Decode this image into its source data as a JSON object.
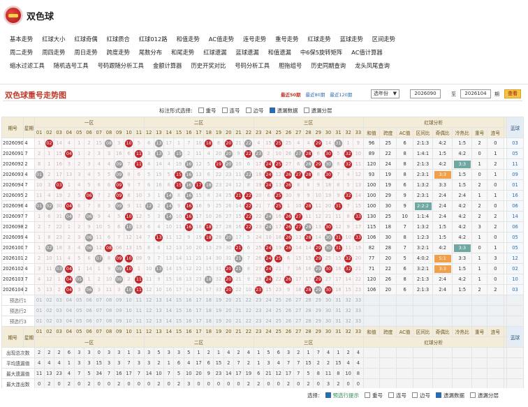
{
  "app": {
    "title": "双色球"
  },
  "nav": [
    [
      "基本走势",
      "红球大小",
      "红球奇偶",
      "红球质合",
      "红球012路",
      "和值走势",
      "AC值走势",
      "连号走势",
      "重号走势",
      "红球走势",
      "蓝球走势",
      "区间走势"
    ],
    [
      "周二走势",
      "周四走势",
      "周日走势",
      "跨度走势",
      "尾数分布",
      "和尾走势",
      "红球遗漏",
      "蓝球遗漏",
      "和值遗漏",
      "中6保5旋转矩阵",
      "AC值计算器"
    ],
    [
      "缩水过滤工具",
      "随机选号工具",
      "号码跟随分析工具",
      "金额计算器",
      "历史开奖对比",
      "号码分析工具",
      "胆拖组号",
      "历史同期查询",
      "龙头凤尾查询"
    ]
  ],
  "header": {
    "title": "双色球重号走势图",
    "ranges": [
      "最近50期",
      "最近80期",
      "最近120期"
    ],
    "select": "选年份",
    "from": "2026090",
    "to": "2026104",
    "to_label": "至",
    "period_unit": "期",
    "button": "查看"
  },
  "top_opts": {
    "label": "标注形式选择:",
    "items": [
      {
        "text": "重号",
        "on": false
      },
      {
        "text": "连号",
        "on": false
      },
      {
        "text": "边号",
        "on": false
      },
      {
        "text": "遗漏数据",
        "on": true
      },
      {
        "text": "遗漏分层",
        "on": false
      }
    ]
  },
  "foot_opts": {
    "label": "选择:",
    "items": [
      {
        "text": "预选行提示",
        "on": true
      },
      {
        "text": "重号",
        "on": false
      },
      {
        "text": "连号",
        "on": false
      },
      {
        "text": "边号",
        "on": false
      },
      {
        "text": "遗漏数据",
        "on": true
      },
      {
        "text": "遗漏分层",
        "on": false
      }
    ]
  },
  "table": {
    "zones": [
      "一区",
      "二区",
      "三区"
    ],
    "analysis_title": "红球分析",
    "period_label": "期号",
    "week_label": "星期",
    "blue_label": "蓝球",
    "analysis_cols": [
      "和值",
      "跨度",
      "AC值",
      "区间比",
      "奇偶比",
      "冷热比",
      "重号",
      "连号"
    ],
    "rows": [
      {
        "p": "2026090",
        "w": "4",
        "m": [
          "1",
          "02",
          "14",
          "4",
          "1",
          "2",
          "15",
          "5",
          "3",
          "2",
          "5",
          "6",
          "2",
          "17",
          "1",
          "7",
          "10",
          "3",
          "8",
          "3",
          "21",
          "8",
          "4",
          "15",
          "9",
          "25",
          "4",
          "4",
          "5",
          "14",
          "4",
          "1",
          "9"
        ],
        "b": [
          "02",
          "10",
          "18",
          "20",
          "25",
          "29"
        ],
        "g": [
          "08",
          "13",
          "22",
          "31"
        ],
        "a": [
          "96",
          "25",
          "6",
          "2:1:3",
          "4:2",
          "1:5",
          "2",
          "0"
        ],
        "t": [],
        "blue": "03"
      },
      {
        "p": "2026091",
        "w": "7",
        "m": [
          "2",
          "1",
          "15",
          "5",
          "1",
          "2",
          "3",
          "3",
          "16",
          "6",
          "4",
          "3",
          "13",
          "3",
          "18",
          "2",
          "11",
          "4",
          "20",
          "21",
          "9",
          "5",
          "16",
          "2",
          "10",
          "26",
          "5",
          "5",
          "6",
          "15",
          "5",
          "2",
          "10"
        ],
        "b": [
          "04",
          "11",
          "22",
          "28",
          "30",
          "32"
        ],
        "g": [
          "13",
          "15",
          "20",
          "23",
          "27"
        ],
        "a": [
          "89",
          "22",
          "8",
          "1:4:1",
          "1:5",
          "4:2",
          "0",
          "1"
        ],
        "t": [],
        "blue": "05"
      },
      {
        "p": "2026092",
        "w": "2",
        "m": [
          "8",
          "1",
          "16",
          "3",
          "2",
          "3",
          "4",
          "4",
          "17",
          "7",
          "5",
          "4",
          "14",
          "4",
          "19",
          "3",
          "12",
          "5",
          "21",
          "22",
          "10",
          "6",
          "17",
          "3",
          "11",
          "27",
          "6",
          "6",
          "7",
          "16",
          "6",
          "3",
          "11"
        ],
        "b": [
          "11",
          "19",
          "24",
          "25",
          "29",
          "32"
        ],
        "g": [
          "09",
          "16",
          "20",
          "28",
          "30"
        ],
        "a": [
          "120",
          "24",
          "8",
          "2:1:3",
          "4:2",
          "3:3",
          "1",
          "2"
        ],
        "t": [
          {
            "i": 5,
            "c": "t"
          }
        ],
        "blue": "11"
      },
      {
        "p": "2026093",
        "w": "4",
        "m": [
          "9",
          "2",
          "17",
          "13",
          "3",
          "4",
          "5",
          "5",
          "18",
          "8",
          "6",
          "5",
          "15",
          "5",
          "20",
          "4",
          "13",
          "6",
          "22",
          "23",
          "11",
          "7",
          "18",
          "4",
          "12",
          "28",
          "7",
          "7",
          "8",
          "17",
          "7",
          "4",
          "12"
        ],
        "b": [
          "15",
          "24",
          "26",
          "27",
          "28",
          "30"
        ],
        "g": [
          "01",
          "09",
          "16",
          "22"
        ],
        "a": [
          "93",
          "19",
          "8",
          "2:3:1",
          "3:3",
          "1:5",
          "0",
          "1"
        ],
        "t": [
          {
            "i": 4,
            "c": "o"
          }
        ],
        "blue": "09"
      },
      {
        "p": "2026094",
        "w": "7",
        "m": [
          "10",
          "3",
          "18",
          "1",
          "4",
          "5",
          "6",
          "6",
          "19",
          "9",
          "7",
          "6",
          "16",
          "6",
          "21",
          "5",
          "14",
          "7",
          "23",
          "24",
          "12",
          "8",
          "19",
          "5",
          "13",
          "29",
          "8",
          "8",
          "9",
          "18",
          "8",
          "5",
          "13"
        ],
        "b": [
          "03",
          "09",
          "15",
          "17",
          "24",
          "26"
        ],
        "g": [
          "16",
          "18",
          "24"
        ],
        "a": [
          "100",
          "19",
          "6",
          "1:3:2",
          "3:3",
          "1:5",
          "2",
          "0"
        ],
        "t": [],
        "blue": "01"
      },
      {
        "p": "2026095",
        "w": "2",
        "m": [
          "11",
          "4",
          "19",
          "2",
          "5",
          "6",
          "7",
          "2",
          "3",
          "8",
          "10",
          "3",
          "1",
          "7",
          "8",
          "6",
          "15",
          "8",
          "24",
          "25",
          "13",
          "1",
          "20",
          "6",
          "14",
          "30",
          "9",
          "9",
          "10",
          "19",
          "9",
          "6",
          "14"
        ],
        "b": [
          "06",
          "09",
          "21",
          "22",
          "25",
          "32"
        ],
        "g": [
          "14",
          "16",
          "22"
        ],
        "a": [
          "100",
          "29",
          "9",
          "2:3:1",
          "2:4",
          "2:4",
          "1",
          "1"
        ],
        "t": [],
        "blue": "16"
      },
      {
        "p": "2026096",
        "w": "4",
        "m": [
          "1",
          "5",
          "30",
          "3",
          "6",
          "7",
          "8",
          "3",
          "4",
          "9",
          "11",
          "4",
          "2",
          "8",
          "9",
          "7",
          "16",
          "9",
          "25",
          "26",
          "14",
          "2",
          "21",
          "7",
          "15",
          "1",
          "10",
          "10",
          "11",
          "20",
          "10",
          "7",
          "15"
        ],
        "b": [
          "04",
          "16",
          "22",
          "25",
          "28",
          "31"
        ],
        "g": [
          "01",
          "02",
          "09",
          "12",
          "14"
        ],
        "a": [
          "100",
          "30",
          "9",
          "2:2:2",
          "2:4",
          "4:2",
          "2",
          "0"
        ],
        "t": [
          {
            "i": 3,
            "c": "t"
          }
        ],
        "blue": "06"
      },
      {
        "p": "2026097",
        "w": "7",
        "m": [
          "1",
          "6",
          "31",
          "1",
          "7",
          "8",
          "9",
          "4",
          "5",
          "10",
          "12",
          "5",
          "3",
          "9",
          "10",
          "8",
          "17",
          "10",
          "26",
          "27",
          "15",
          "3",
          "22",
          "8",
          "16",
          "2",
          "11",
          "11",
          "12",
          "21",
          "11",
          "8",
          "16"
        ],
        "b": [
          "10",
          "16",
          "22",
          "26",
          "27",
          "33"
        ],
        "g": [
          "04",
          "06",
          "14",
          "22",
          "24"
        ],
        "a": [
          "130",
          "25",
          "10",
          "1:1:4",
          "2:4",
          "4:2",
          "2",
          "2"
        ],
        "t": [],
        "blue": "14"
      },
      {
        "p": "2026098",
        "w": "2",
        "m": [
          "2",
          "7",
          "22",
          "1",
          "2",
          "9",
          "10",
          "5",
          "6",
          "11",
          "13",
          "6",
          "4",
          "10",
          "11",
          "8",
          "18",
          "11",
          "27",
          "28",
          "16",
          "4",
          "23",
          "9",
          "17",
          "3",
          "12",
          "12",
          "13",
          "22",
          "12",
          "9",
          "17"
        ],
        "b": [
          "16",
          "18",
          "22",
          "26",
          "27",
          "30"
        ],
        "g": [
          "10",
          "24",
          "28"
        ],
        "a": [
          "115",
          "18",
          "7",
          "1:3:2",
          "1:5",
          "4:2",
          "3",
          "2"
        ],
        "t": [],
        "blue": "06"
      },
      {
        "p": "2026099",
        "w": "4",
        "m": [
          "1",
          "8",
          "23",
          "2",
          "3",
          "1",
          "11",
          "6",
          "7",
          "12",
          "14",
          "7",
          "5",
          "11",
          "12",
          "9",
          "19",
          "12",
          "28",
          "29",
          "17",
          "5",
          "24",
          "10",
          "18",
          "4",
          "13",
          "13",
          "14",
          "23",
          "13",
          "10",
          "18"
        ],
        "b": [
          "13",
          "18",
          "26",
          "28",
          "31",
          "33"
        ],
        "g": [
          "06",
          "20",
          "26",
          "30"
        ],
        "a": [
          "106",
          "30",
          "8",
          "1:2:3",
          "1:5",
          "4:2",
          "1",
          "0"
        ],
        "t": [],
        "blue": "05"
      },
      {
        "p": "2026100",
        "w": "7",
        "m": [
          "1",
          "9",
          "18",
          "3",
          "4",
          "5",
          "12",
          "7",
          "06",
          "13",
          "15",
          "8",
          "6",
          "12",
          "13",
          "10",
          "20",
          "13",
          "29",
          "30",
          "18",
          "6",
          "25",
          "11",
          "19",
          "5",
          "14",
          "14",
          "15",
          "24",
          "14",
          "11",
          "19"
        ],
        "b": [
          "08",
          "21",
          "24",
          "26",
          "29",
          "31"
        ],
        "g": [
          "02",
          "06",
          "30"
        ],
        "a": [
          "82",
          "28",
          "7",
          "3:2:1",
          "4:2",
          "3:3",
          "0",
          "1"
        ],
        "t": [
          {
            "i": 5,
            "c": "t"
          }
        ],
        "blue": "05"
      },
      {
        "p": "2026101",
        "w": "2",
        "m": [
          "2",
          "10",
          "11",
          "4",
          "5",
          "6",
          "13",
          "8",
          "1",
          "14",
          "09",
          "9",
          "7",
          "13",
          "14",
          "11",
          "21",
          "14",
          "30",
          "31",
          "19",
          "7",
          "26",
          "12",
          "20",
          "6",
          "15",
          "15",
          "16",
          "25",
          "15",
          "12",
          "20"
        ],
        "b": [
          "09",
          "10",
          "24",
          "25",
          "29",
          "32"
        ],
        "g": [
          "07",
          "09",
          "21"
        ],
        "a": [
          "77",
          "20",
          "5",
          "4:0:2",
          "5:1",
          "3:3",
          "1",
          "3"
        ],
        "t": [
          {
            "i": 4,
            "c": "o"
          }
        ],
        "blue": "12"
      },
      {
        "p": "2026102",
        "w": "4",
        "m": [
          "3",
          "11",
          "4",
          "04",
          "1",
          "14",
          "1",
          "9",
          "1",
          "1",
          "1",
          "10",
          "8",
          "14",
          "15",
          "12",
          "22",
          "15",
          "31",
          "32",
          "20",
          "8",
          "27",
          "13",
          "21",
          "7",
          "16",
          "16",
          "17",
          "26",
          "16",
          "13",
          "21"
        ],
        "b": [
          "04",
          "10",
          "20",
          "24",
          "30",
          "32"
        ],
        "g": [
          "03",
          "09",
          "13",
          "21",
          "29"
        ],
        "a": [
          "71",
          "22",
          "6",
          "3:2:1",
          "3:3",
          "1:5",
          "1",
          "0"
        ],
        "t": [
          {
            "i": 4,
            "c": "o"
          }
        ],
        "blue": "02"
      },
      {
        "p": "2026103",
        "w": "7",
        "m": [
          "4",
          "12",
          "1",
          "04",
          "2",
          "1",
          "2",
          "10",
          "2",
          "2",
          "11",
          "11",
          "9",
          "15",
          "16",
          "13",
          "23",
          "16",
          "32",
          "20",
          "21",
          "9",
          "28",
          "14",
          "22",
          "8",
          "17",
          "17",
          "18",
          "27",
          "17",
          "14",
          "22"
        ],
        "b": [
          "04",
          "11",
          "20",
          "24",
          "26",
          "29"
        ],
        "g": [
          "05",
          "09",
          "18"
        ],
        "a": [
          "120",
          "26",
          "8",
          "2:1:3",
          "2:4",
          "4:2",
          "1",
          "0"
        ],
        "t": [],
        "blue": "10"
      },
      {
        "p": "2026104",
        "w": "2",
        "m": [
          "5",
          "13",
          "2",
          "1",
          "3",
          "2",
          "3",
          "11",
          "3",
          "3",
          "11",
          "12",
          "10",
          "16",
          "17",
          "14",
          "24",
          "17",
          "33",
          "20",
          "22",
          "10",
          "29",
          "15",
          "23",
          "9",
          "18",
          "18",
          "19",
          "28",
          "18",
          "15",
          "23"
        ],
        "b": [
          "04",
          "11",
          "20",
          "23",
          "28",
          "30"
        ],
        "g": [
          "06",
          "10",
          "29"
        ],
        "a": [
          "106",
          "20",
          "6",
          "2:1:3",
          "2:4",
          "1:5",
          "2",
          "2"
        ],
        "t": [],
        "blue": "03"
      }
    ],
    "preselect": [
      "预选行1",
      "预选行2",
      "预选行3"
    ],
    "stats": [
      {
        "label": "出现总次数",
        "v": [
          "2",
          "2",
          "2",
          "6",
          "3",
          "3",
          "0",
          "3",
          "3",
          "1",
          "3",
          "3",
          "5",
          "3",
          "3",
          "5",
          "1",
          "2",
          "1",
          "4",
          "2",
          "4",
          "1",
          "5",
          "6",
          "3",
          "2",
          "1",
          "7",
          "4",
          "1",
          "2",
          "4"
        ]
      },
      {
        "label": "平均遗漏值",
        "v": [
          "4",
          "4",
          "4",
          "1",
          "3",
          "3",
          "15",
          "3",
          "3",
          "7",
          "3",
          "3",
          "2",
          "1",
          "6",
          "4",
          "17",
          "6",
          "15",
          "2",
          "7",
          "2",
          "1",
          "3",
          "4",
          "7",
          "7",
          "15",
          "2",
          "2",
          "15",
          "4",
          "4"
        ]
      },
      {
        "label": "最大遗漏值",
        "v": [
          "11",
          "13",
          "23",
          "4",
          "7",
          "5",
          "34",
          "7",
          "16",
          "17",
          "7",
          "14",
          "10",
          "7",
          "5",
          "10",
          "20",
          "9",
          "23",
          "14",
          "17",
          "19",
          "6",
          "21",
          "12",
          "17",
          "7",
          "5",
          "8",
          "11",
          "8",
          "10",
          "8"
        ]
      },
      {
        "label": "最大连出数",
        "v": [
          "0",
          "2",
          "0",
          "2",
          "0",
          "2",
          "0",
          "0",
          "2",
          "0",
          "0",
          "0",
          "2",
          "0",
          "2",
          "3",
          "0",
          "0",
          "0",
          "0",
          "0",
          "2",
          "2",
          "0",
          "0",
          "2",
          "0",
          "2",
          "0",
          "3",
          "2",
          "0",
          "0"
        ]
      }
    ]
  },
  "colors": {
    "red_ball": "#c0272d",
    "title_red": "#c0392b",
    "header_beige": "#f3ecd9",
    "orange_tag": "#f0a04b",
    "teal_tag": "#6fa7a3"
  }
}
